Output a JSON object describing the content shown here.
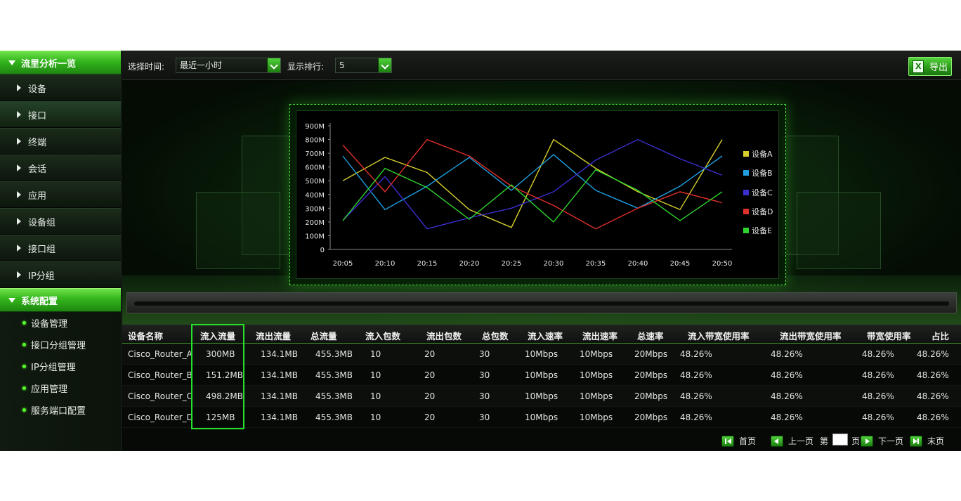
{
  "sidebar": {
    "section1": {
      "title": "流里分析一览"
    },
    "items": [
      {
        "label": "设备"
      },
      {
        "label": "接口"
      },
      {
        "label": "终端"
      },
      {
        "label": "会话"
      },
      {
        "label": "应用"
      },
      {
        "label": "设备组"
      },
      {
        "label": "接口组"
      },
      {
        "label": "IP分组"
      }
    ],
    "section2": {
      "title": "系统配置"
    },
    "sub_items": [
      {
        "label": "设备管理"
      },
      {
        "label": "接口分组管理"
      },
      {
        "label": "IP分组管理"
      },
      {
        "label": "应用管理"
      },
      {
        "label": "服务端口配置"
      }
    ]
  },
  "toolbar": {
    "time_label": "选择时间:",
    "time_value": "最近一小时",
    "rank_label": "显示排行:",
    "rank_value": "5",
    "export_label": "导出"
  },
  "colors": {
    "accent": "#3fc22a",
    "highlight": "#27e02a"
  },
  "chart_data": {
    "type": "line",
    "x": [
      "20:05",
      "20:10",
      "20:15",
      "20:20",
      "20:25",
      "20:30",
      "20:35",
      "20:40",
      "20:45",
      "20:50"
    ],
    "y_ticks": [
      "0",
      "100M",
      "200M",
      "300M",
      "400M",
      "500M",
      "600M",
      "700M",
      "800M",
      "900M"
    ],
    "ylim": [
      0,
      900
    ],
    "series": [
      {
        "name": "设备A",
        "color": "#d7cf2d",
        "values": [
          500,
          670,
          560,
          290,
          160,
          800,
          590,
          420,
          290,
          800
        ]
      },
      {
        "name": "设备B",
        "color": "#1f9ee0",
        "values": [
          680,
          290,
          460,
          670,
          430,
          690,
          430,
          300,
          460,
          680
        ]
      },
      {
        "name": "设备C",
        "color": "#3b2fd0",
        "values": [
          210,
          530,
          150,
          230,
          300,
          420,
          650,
          800,
          660,
          540
        ]
      },
      {
        "name": "设备D",
        "color": "#e0302a",
        "values": [
          760,
          420,
          800,
          680,
          460,
          320,
          150,
          300,
          420,
          340
        ]
      },
      {
        "name": "设备E",
        "color": "#2fd52f",
        "values": [
          210,
          590,
          450,
          220,
          470,
          200,
          580,
          430,
          210,
          420
        ]
      }
    ]
  },
  "table": {
    "headers": [
      "设备名称",
      "流入流量",
      "流出流量",
      "总流量",
      "流入包数",
      "流出包数",
      "总包数",
      "流入速率",
      "流出速率",
      "总速率",
      "流入带宽使用率",
      "流出带宽使用率",
      "带宽使用率",
      "占比"
    ],
    "rows": [
      [
        "Cisco_Router_A",
        "300MB",
        "134.1MB",
        "455.3MB",
        "10",
        "20",
        "30",
        "10Mbps",
        "10Mbps",
        "20Mbps",
        "48.26%",
        "48.26%",
        "48.26%",
        "48.26%"
      ],
      [
        "Cisco_Router_B",
        "151.2MB",
        "134.1MB",
        "455.3MB",
        "10",
        "20",
        "30",
        "10Mbps",
        "10Mbps",
        "20Mbps",
        "48.26%",
        "48.26%",
        "48.26%",
        "48.26%"
      ],
      [
        "Cisco_Router_C",
        "498.2MB",
        "134.1MB",
        "455.3MB",
        "10",
        "20",
        "30",
        "10Mbps",
        "10Mbps",
        "20Mbps",
        "48.26%",
        "48.26%",
        "48.26%",
        "48.26%"
      ],
      [
        "Cisco_Router_D",
        "125MB",
        "134.1MB",
        "455.3MB",
        "10",
        "20",
        "30",
        "10Mbps",
        "10Mbps",
        "20Mbps",
        "48.26%",
        "48.26%",
        "48.26%",
        "48.26%"
      ]
    ]
  },
  "pager": {
    "first": "首页",
    "prev": "上一页",
    "page_prefix": "第",
    "page_suffix": "页",
    "next": "下一页",
    "last": "末页"
  }
}
